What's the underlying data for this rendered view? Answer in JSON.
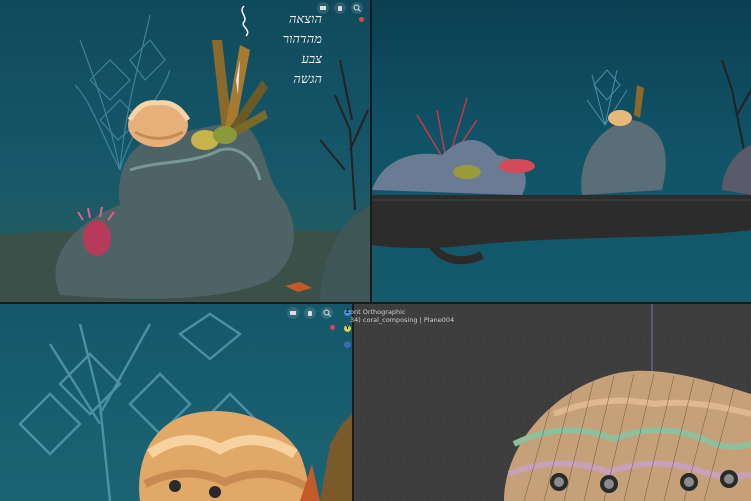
{
  "viewports": {
    "top_left": {
      "handwritten_notes": [
        "הוצאה",
        "מהדהור",
        "צבע",
        "הגשה"
      ]
    },
    "bottom_right": {
      "view_label": "ont Orthographic",
      "object_label": "34) coral_composing | Plane004",
      "axis_z": "Z",
      "axis_y": "Y"
    }
  },
  "icons": [
    "camera-icon",
    "hand-pan-icon",
    "zoom-icon",
    "record-icon",
    "stroke-icon"
  ],
  "colors": {
    "water": "#115266",
    "rock": "#4a6468",
    "coral_orange": "#f0b878",
    "coral_red": "#c23a4a",
    "grid_bg": "#3d3d3d",
    "axis_blue": "#4a90e2",
    "axis_yellow": "#c8d44a"
  }
}
